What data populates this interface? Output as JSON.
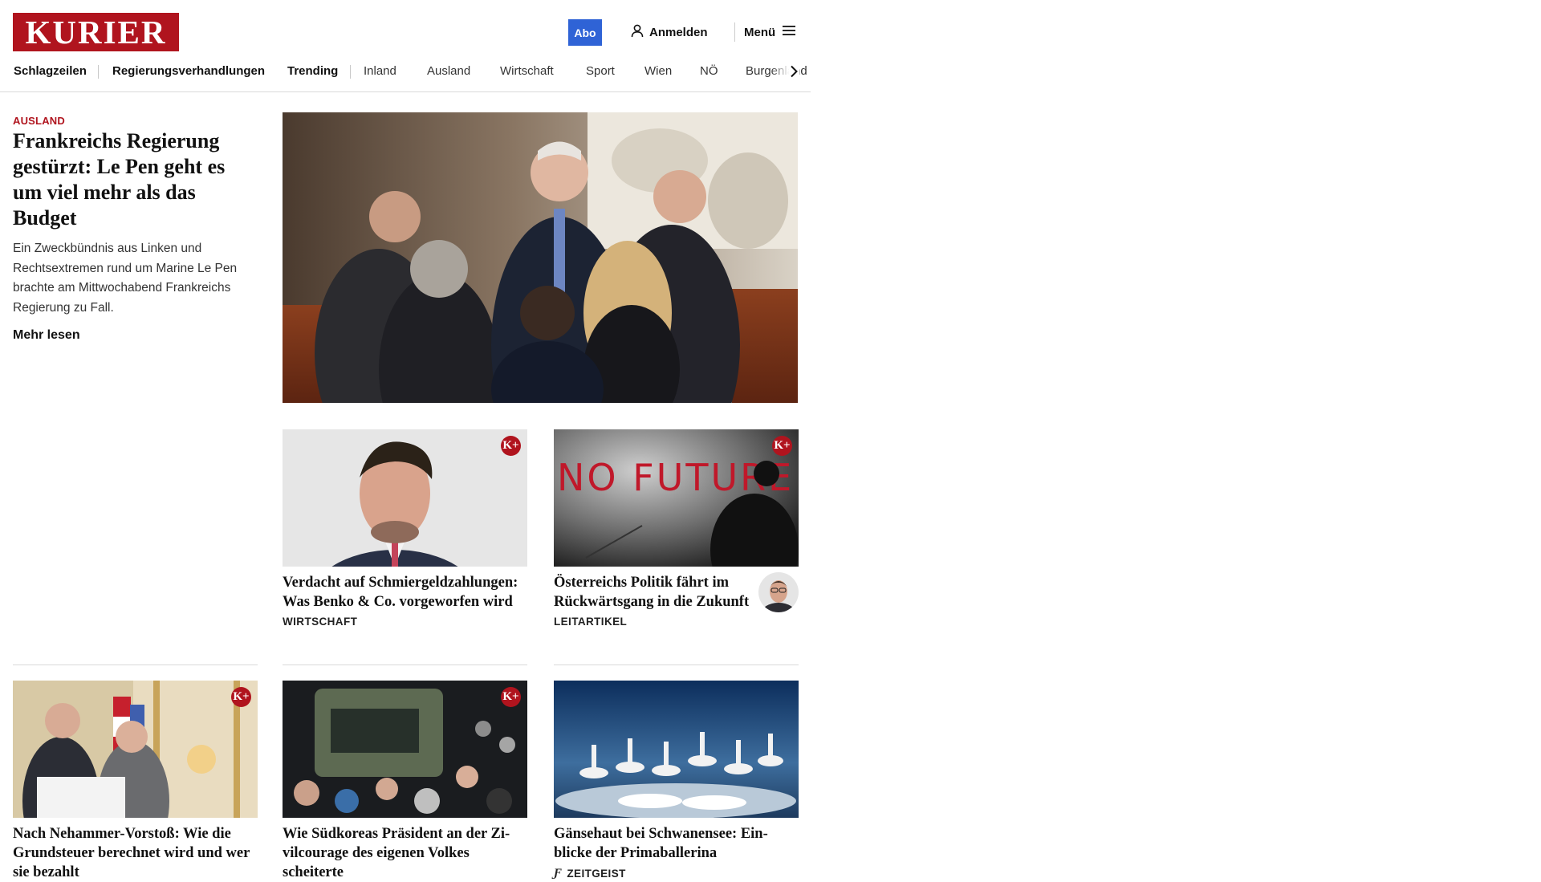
{
  "brand": {
    "logo_text": "KURIER",
    "color": "#b0141e",
    "abo_color": "#2f63d6"
  },
  "header": {
    "abo_label": "Abo",
    "login_label": "Anmelden",
    "menu_label": "Menü"
  },
  "nav": {
    "items": [
      "Schlagzeilen",
      "Regierungsverhandlungen",
      "Trending",
      "Inland",
      "Ausland",
      "Wirtschaft",
      "Sport",
      "Wien",
      "NÖ",
      "Burgenland"
    ]
  },
  "icons": {
    "user": "user-icon",
    "menu": "hamburger-menu-icon",
    "next": "chevron-right-icon",
    "kplus": "k-plus-badge-icon",
    "zeitgeist": "zeitgeist-f-icon"
  },
  "lead": {
    "category": "AUSLAND",
    "title": "Frankreichs Regierung gestürzt: Le Pen geht es um viel mehr als das Budget",
    "teaser": "Ein Zweckbündnis aus Linken und Rechtsextremen rund um Marine Le Pen brachte am Mittwochabend Frankreichs Regierung zu Fall.",
    "read_more": "Mehr lesen"
  },
  "cards": [
    {
      "title": "Verdacht auf Schmiergeldzahlun­gen: Was Benko & Co. vorgeworfen wird",
      "category": "WIRTSCHAFT",
      "premium": true,
      "badge_text": "K+"
    },
    {
      "title": "Österreichs Politik fährt im Rückwärtsgang in die Zukunft",
      "category": "LEITARTIKEL",
      "premium": true,
      "badge_text": "K+",
      "graffiti_text": "NO FUTURE"
    },
    {
      "title": "Nach Nehammer-Vorstoß: Wie die Grundsteuer berechnet wird und wer sie bezahlt",
      "premium": true,
      "badge_text": "K+"
    },
    {
      "title": "Wie Südkoreas Präsident an der Zi­vilcourage des eigenen Volkes scheiterte",
      "premium": true,
      "badge_text": "K+"
    },
    {
      "title": "Gänsehaut bei Schwanensee: Ein­blicke der Primaballerina",
      "category": "ZEITGEIST",
      "premium": false
    }
  ]
}
